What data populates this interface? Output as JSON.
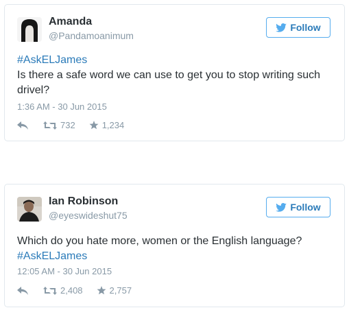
{
  "tweets": [
    {
      "name": "Amanda",
      "handle": "@Pandamoanimum",
      "follow_label": "Follow",
      "hashtag": "#AskELJames",
      "text": "Is there a safe word we can use to get you to stop writing such drivel?",
      "timestamp": "1:36 AM - 30 Jun 2015",
      "retweets": "732",
      "favorites": "1,234"
    },
    {
      "name": "Ian Robinson",
      "handle": "@eyeswideshut75",
      "follow_label": "Follow",
      "hashtag": "#AskELJames",
      "text": "Which do you hate more, women or the English language?",
      "timestamp": "12:05 AM - 30 Jun 2015",
      "retweets": "2,408",
      "favorites": "2,757"
    }
  ],
  "colors": {
    "link": "#2b7bb9",
    "follow_border": "#55acee",
    "muted": "#8899a6",
    "text": "#292f33",
    "border": "#e1e8ed"
  },
  "icons": {
    "follow": "bird-icon",
    "reply": "reply-icon",
    "retweet": "retweet-icon",
    "favorite": "star-icon"
  }
}
